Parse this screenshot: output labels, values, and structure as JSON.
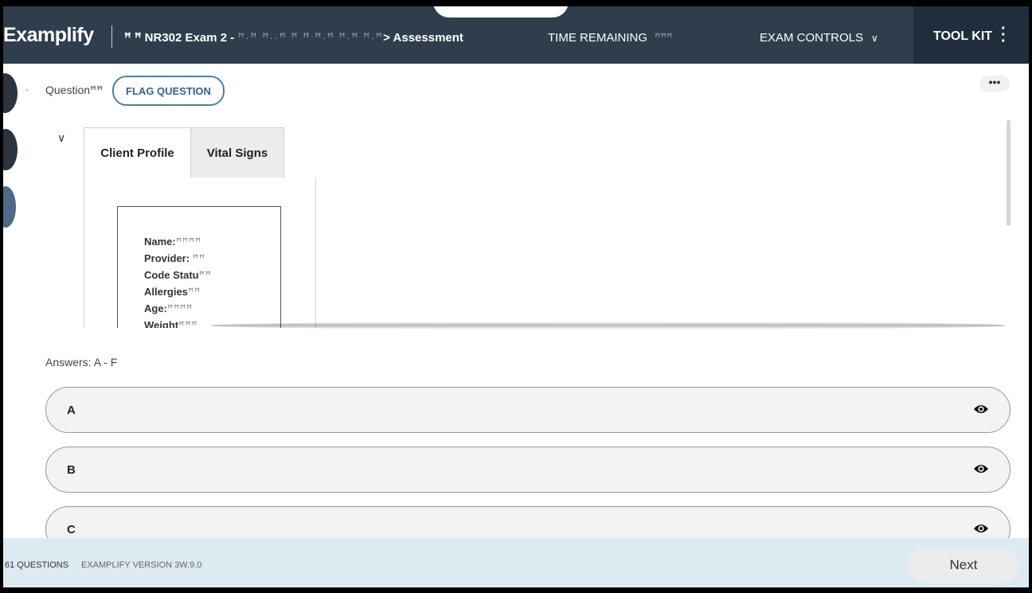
{
  "header": {
    "logo": "Examplify",
    "exam_prefix": "ꟸ ꟸ NR302 Exam 2 - ",
    "exam_obscured": "ꟸ·ꟸ ꟸ··ꟸ ꟸ ꟸ ꟸ·ꟸ ꟸ·ꟸ ꟸ·ꟸ",
    "exam_suffix": "> Assessment",
    "time_label": "TIME REMAINING",
    "time_value": "ꟸꟸꟸ",
    "exam_controls": "EXAM CONTROLS",
    "toolkit": "TOOL KIT"
  },
  "question": {
    "label": "Questionꟸꟸ",
    "flag_label": "FLAG QUESTION",
    "more_label": "•••"
  },
  "tabs": [
    {
      "label": "Client Profile",
      "active": true
    },
    {
      "label": "Vital Signs",
      "active": false
    }
  ],
  "profile": {
    "name_label": "Name:",
    "name_value": "ꟸꟸꟸꟸ",
    "provider_label": "Provider:",
    "provider_value": "ꟸꟸ",
    "code_label": "Code Statu",
    "code_value": "ꟸꟸ",
    "allergies_label": "Allergies",
    "allergies_value": "ꟸꟸ",
    "age_label": "Age:",
    "age_value": "ꟸꟸꟸꟸ",
    "weight_label": "Weight",
    "weight_value": "ꟸꟸꟸ"
  },
  "answers": {
    "label": "Answers: A - F",
    "items": [
      {
        "letter": "A"
      },
      {
        "letter": "B"
      },
      {
        "letter": "C"
      }
    ]
  },
  "footer": {
    "questions": "61 QUESTIONS",
    "version": "EXAMPLIFY VERSION 3W.9.0",
    "next_label": "Next"
  },
  "colors": {
    "header_bg": "#2f3e4d",
    "toolkit_bg": "#1f2d3c",
    "flag_border": "#4a7fa8",
    "footer_bg": "#ddeaf2"
  }
}
